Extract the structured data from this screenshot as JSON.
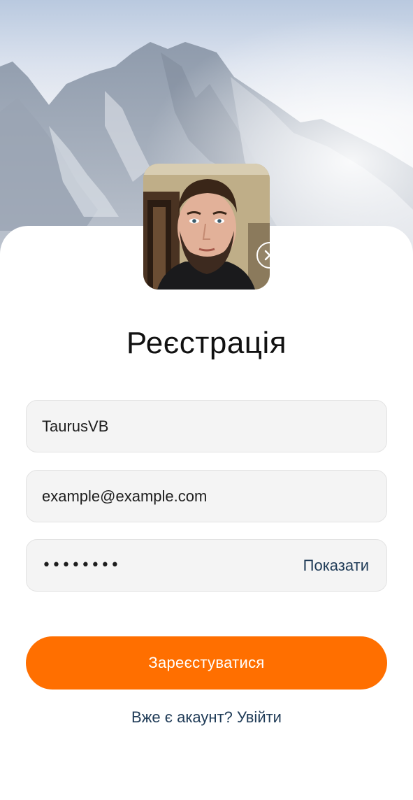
{
  "title": "Реєстрація",
  "form": {
    "username_value": "TaurusVB",
    "email_value": "example@example.com",
    "password_masked": "••••••••",
    "show_password_label": "Показати"
  },
  "register_button_label": "Зареєстуватися",
  "login_link_label": "Вже є акаунт? Увійти",
  "colors": {
    "accent": "#ff6f00",
    "link": "#1f3b57",
    "field_background": "#f4f4f4"
  },
  "icons": {
    "remove_photo": "close-circle-icon"
  }
}
